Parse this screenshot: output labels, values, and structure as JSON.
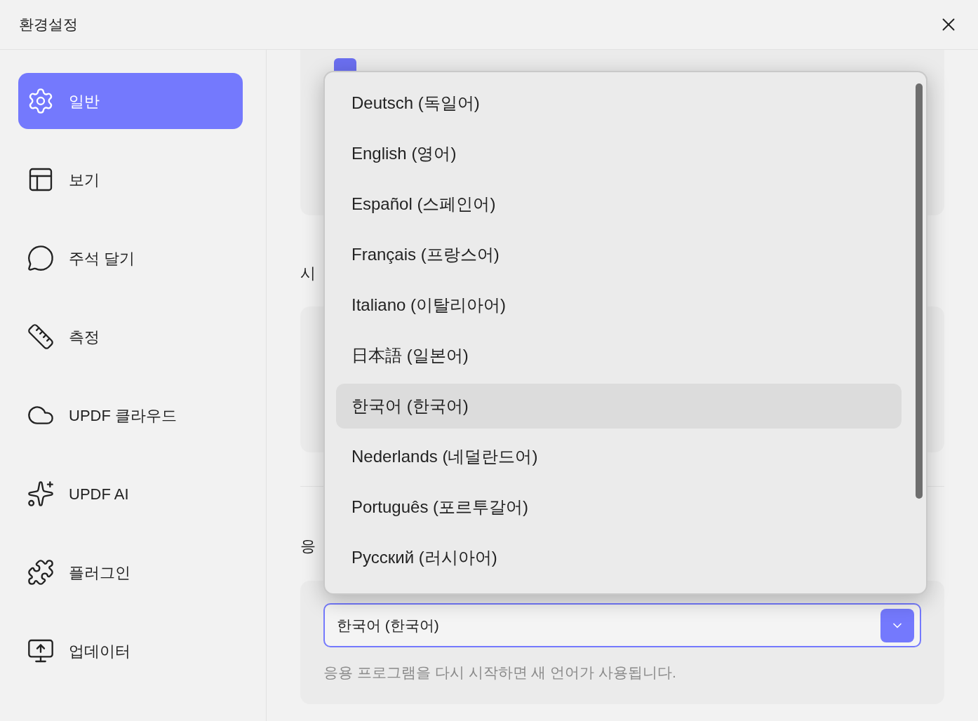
{
  "window": {
    "title": "환경설정"
  },
  "sidebar": {
    "items": [
      {
        "kind": "gear",
        "label": "일반",
        "selected": true
      },
      {
        "kind": "layout",
        "label": "보기",
        "selected": false
      },
      {
        "kind": "comment",
        "label": "주석 달기",
        "selected": false
      },
      {
        "kind": "ruler",
        "label": "측정",
        "selected": false
      },
      {
        "kind": "cloud",
        "label": "UPDF 클라우드",
        "selected": false
      },
      {
        "kind": "ai",
        "label": "UPDF AI",
        "selected": false
      },
      {
        "kind": "plugin",
        "label": "플러그인",
        "selected": false
      },
      {
        "kind": "update",
        "label": "업데이터",
        "selected": false
      }
    ]
  },
  "content": {
    "checkbox": {
      "checked": true
    },
    "section_heading_1": "시",
    "section_heading_2": "응",
    "language_select": {
      "value": "한국어 (한국어)"
    },
    "hint": "응용 프로그램을 다시 시작하면 새 언어가 사용됩니다."
  },
  "dropdown": {
    "options": [
      {
        "label": "Deutsch (독일어)",
        "selected": false
      },
      {
        "label": "English (영어)",
        "selected": false
      },
      {
        "label": "Español (스페인어)",
        "selected": false
      },
      {
        "label": "Français (프랑스어)",
        "selected": false
      },
      {
        "label": "Italiano (이탈리아어)",
        "selected": false
      },
      {
        "label": "日本語 (일본어)",
        "selected": false
      },
      {
        "label": "한국어 (한국어)",
        "selected": true
      },
      {
        "label": "Nederlands (네덜란드어)",
        "selected": false
      },
      {
        "label": "Português (포르투갈어)",
        "selected": false
      },
      {
        "label": "Русский (러시아어)",
        "selected": false
      }
    ]
  }
}
